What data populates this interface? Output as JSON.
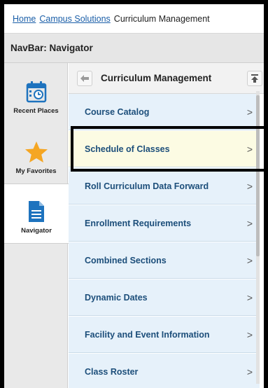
{
  "breadcrumb": {
    "home": "Home",
    "campus": "Campus Solutions",
    "current": "Curriculum Management"
  },
  "header": {
    "title": "NavBar: Navigator"
  },
  "rail": {
    "items": [
      {
        "label": "Recent Places",
        "icon": "calendar-clock-icon"
      },
      {
        "label": "My Favorites",
        "icon": "star-icon"
      },
      {
        "label": "Navigator",
        "icon": "document-icon"
      }
    ]
  },
  "content": {
    "title": "Curriculum Management"
  },
  "list": {
    "items": [
      {
        "label": "Course Catalog"
      },
      {
        "label": "Schedule of Classes"
      },
      {
        "label": "Roll Curriculum Data Forward"
      },
      {
        "label": "Enrollment Requirements"
      },
      {
        "label": "Combined Sections"
      },
      {
        "label": "Dynamic Dates"
      },
      {
        "label": "Facility and Event Information"
      },
      {
        "label": "Class Roster"
      }
    ],
    "chevron": ">"
  },
  "colors": {
    "link": "#1a5ea8",
    "item_bg": "#e6f1fa",
    "item_text": "#1c4e7a",
    "highlight_bg": "#fcfbe3",
    "star": "#f5a623",
    "icon_blue": "#1e73be"
  }
}
